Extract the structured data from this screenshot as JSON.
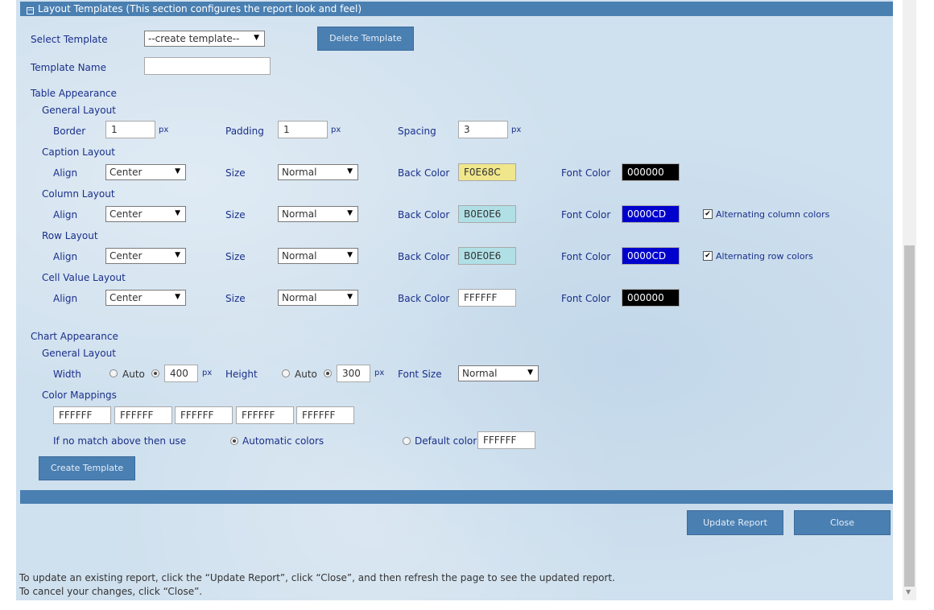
{
  "header": {
    "toggle_glyph": "−",
    "title": "Layout Templates (This section configures the report look and feel)"
  },
  "template": {
    "select_label": "Select Template",
    "select_value": "--create template--",
    "delete_label": "Delete Template",
    "name_label": "Template Name",
    "name_value": ""
  },
  "table": {
    "section_label": "Table Appearance",
    "general": {
      "label": "General Layout",
      "border_label": "Border",
      "border_value": "1",
      "padding_label": "Padding",
      "padding_value": "1",
      "spacing_label": "Spacing",
      "spacing_value": "3",
      "unit": "px"
    },
    "common": {
      "align_label": "Align",
      "size_label": "Size",
      "back_label": "Back Color",
      "font_label": "Font Color"
    },
    "caption": {
      "label": "Caption Layout",
      "align": "Center",
      "size": "Normal",
      "back_color": "F0E68C",
      "font_color": "000000"
    },
    "column": {
      "label": "Column Layout",
      "align": "Center",
      "size": "Normal",
      "back_color": "B0E0E6",
      "font_color": "0000CD",
      "alt_label": "Alternating column colors",
      "alt_checked": true
    },
    "row": {
      "label": "Row Layout",
      "align": "Center",
      "size": "Normal",
      "back_color": "B0E0E6",
      "font_color": "0000CD",
      "alt_label": "Alternating row colors",
      "alt_checked": true
    },
    "cell": {
      "label": "Cell Value Layout",
      "align": "Center",
      "size": "Normal",
      "back_color": "FFFFFF",
      "font_color": "000000"
    }
  },
  "chart": {
    "section_label": "Chart Appearance",
    "general_label": "General Layout",
    "width_label": "Width",
    "width_auto_label": "Auto",
    "width_value": "400",
    "height_label": "Height",
    "height_auto_label": "Auto",
    "height_value": "300",
    "unit": "px",
    "font_size_label": "Font Size",
    "font_size_value": "Normal",
    "mappings_label": "Color Mappings",
    "mappings": [
      "FFFFFF",
      "FFFFFF",
      "FFFFFF",
      "FFFFFF",
      "FFFFFF"
    ],
    "fallback_label": "If no match above then use",
    "auto_colors_label": "Automatic colors",
    "default_color_label": "Default color",
    "default_color_value": "FFFFFF"
  },
  "create_label": "Create Template",
  "actions": {
    "update_label": "Update Report",
    "close_label": "Close"
  },
  "footer": {
    "line1": "To update an existing report, click the “Update Report”, click “Close”, and then refresh the page to see the updated report.",
    "line2": "To cancel your changes, click “Close”."
  },
  "colors": {
    "header_bar": "#4A7FB1",
    "swatches": {
      "F0E68C": "#F0E68C",
      "B0E0E6": "#B0E0E6",
      "FFFFFF": "#FFFFFF",
      "000000": "#000000",
      "0000CD": "#0000CD"
    }
  }
}
